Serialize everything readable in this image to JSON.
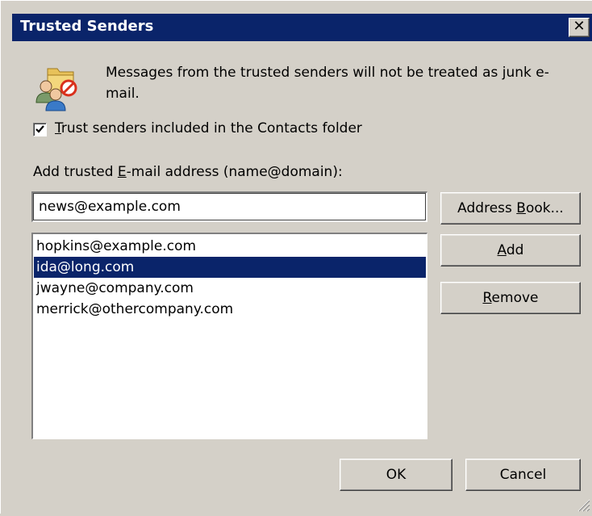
{
  "window": {
    "title": "Trusted Senders",
    "close_glyph": "✕"
  },
  "info": {
    "icon": "people-icon",
    "text": "Messages from the trusted senders will not be treated as junk e-mail."
  },
  "trust_contacts": {
    "checked": true,
    "label_accel": "T",
    "label_rest": "rust senders included in the Contacts folder"
  },
  "add_field": {
    "label_pre": "Add trusted ",
    "label_accel": "E",
    "label_post": "-mail address (name@domain):",
    "value": "news@example.com"
  },
  "senders": [
    {
      "address": "hopkins@example.com",
      "selected": false
    },
    {
      "address": "ida@long.com",
      "selected": true
    },
    {
      "address": "jwayne@company.com",
      "selected": false
    },
    {
      "address": "merrick@othercompany.com",
      "selected": false
    }
  ],
  "buttons": {
    "address_book_pre": "Address ",
    "address_book_accel": "B",
    "address_book_post": "ook...",
    "add_accel": "A",
    "add_rest": "dd",
    "remove_accel": "R",
    "remove_rest": "emove",
    "ok": "OK",
    "cancel": "Cancel"
  },
  "colors": {
    "titlebar": "#0a246a",
    "selection": "#0a246a",
    "face": "#d4d0c8"
  }
}
